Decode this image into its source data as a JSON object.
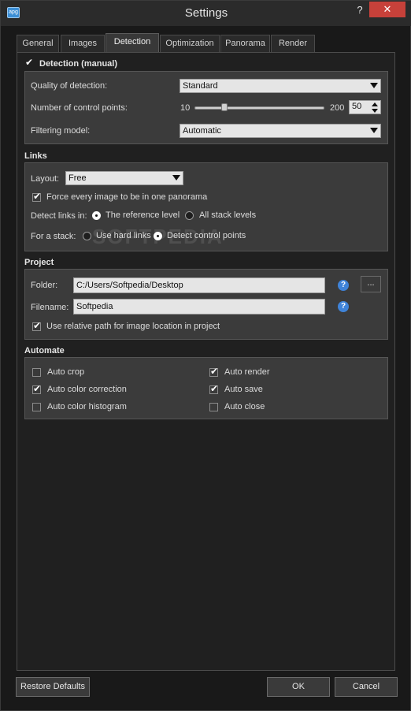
{
  "window": {
    "title": "Settings",
    "app_icon_text": "apg",
    "help_label": "?",
    "close_label": "✕"
  },
  "tabs": [
    {
      "label": "General",
      "active": false
    },
    {
      "label": "Images",
      "active": false
    },
    {
      "label": "Detection",
      "active": true
    },
    {
      "label": "Optimization",
      "active": false
    },
    {
      "label": "Panorama",
      "active": false
    },
    {
      "label": "Render",
      "active": false
    }
  ],
  "detection": {
    "title": "Detection (manual)",
    "checked": true,
    "quality_label": "Quality of detection:",
    "quality_value": "Standard",
    "control_points_label": "Number of control points:",
    "slider_min": "10",
    "slider_max": "200",
    "control_points_value": "50",
    "filtering_label": "Filtering model:",
    "filtering_value": "Automatic"
  },
  "links": {
    "title": "Links",
    "layout_label": "Layout:",
    "layout_value": "Free",
    "force_label": "Force every image to be in one panorama",
    "force_checked": true,
    "detect_in_label": "Detect links in:",
    "ref_level_label": "The reference level",
    "ref_level_selected": true,
    "all_levels_label": "All stack levels",
    "all_levels_selected": false,
    "stack_label": "For a stack:",
    "hard_links_label": "Use hard links",
    "hard_links_selected": false,
    "control_points_label": "Detect control points",
    "control_points_selected": true
  },
  "project": {
    "title": "Project",
    "folder_label": "Folder:",
    "folder_value": "C:/Users/Softpedia/Desktop",
    "browse_label": "...",
    "filename_label": "Filename:",
    "filename_value": "Softpedia",
    "help_icon": "?",
    "relative_label": "Use relative path for image location in project",
    "relative_checked": true
  },
  "automate": {
    "title": "Automate",
    "items": [
      {
        "label": "Auto crop",
        "checked": false
      },
      {
        "label": "Auto render",
        "checked": true
      },
      {
        "label": "Auto color correction",
        "checked": true
      },
      {
        "label": "Auto save",
        "checked": true
      },
      {
        "label": "Auto color histogram",
        "checked": false
      },
      {
        "label": "Auto close",
        "checked": false
      }
    ]
  },
  "footer": {
    "restore_label": "Restore Defaults",
    "ok_label": "OK",
    "cancel_label": "Cancel"
  },
  "watermark": "SOFTPEDIA",
  "colors": {
    "window_bg": "#191919",
    "group_bg": "#3b3b3b",
    "close_red": "#c7413a",
    "info_blue": "#3f83d8"
  }
}
